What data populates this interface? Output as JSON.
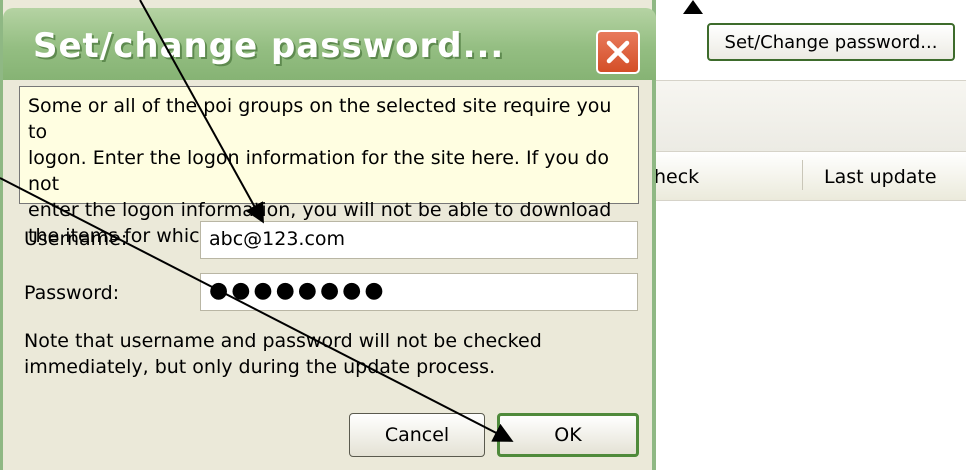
{
  "background_app": {
    "set_change_password_label": "Set/Change password...",
    "columns": [
      "heck",
      "Last update"
    ]
  },
  "dialog": {
    "title": "Set/change password...",
    "info_text_lines": [
      "Some or all of the poi groups on the selected site require you to",
      "logon. Enter the logon information for the site here. If you do not",
      "enter the logon information, you will not be able to download",
      "the items for which logging in is required."
    ],
    "username_label": "Username:",
    "username_value": "abc@123.com",
    "password_label": "Password:",
    "password_value": "●●●●●●●●",
    "note_lines": [
      "Note that username and password will not be checked",
      "immediately, but only during the update process."
    ],
    "cancel_label": "Cancel",
    "ok_label": "OK"
  },
  "icons": {
    "close": "close-x-icon"
  },
  "colors": {
    "titlebar": "#94be82",
    "close_button": "#d44e27",
    "info_background": "#fffee1",
    "dialog_background": "#ebe9d9"
  }
}
